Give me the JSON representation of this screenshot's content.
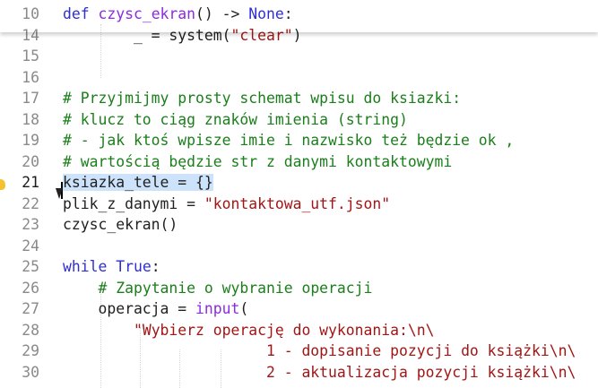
{
  "editor": {
    "lines": [
      {
        "num": "10",
        "parts": [
          {
            "t": "def",
            "c": "kw"
          },
          {
            "t": " "
          },
          {
            "t": "czysc_ekran",
            "c": "fn"
          },
          {
            "t": "() -> "
          },
          {
            "t": "None",
            "c": "kw"
          },
          {
            "t": ":"
          }
        ]
      },
      {
        "num": "14",
        "parts": [
          {
            "t": "        _ = system("
          },
          {
            "t": "\"clear\"",
            "c": "str"
          },
          {
            "t": ")"
          }
        ]
      },
      {
        "num": "15",
        "parts": []
      },
      {
        "num": "16",
        "parts": []
      },
      {
        "num": "17",
        "parts": [
          {
            "t": "# Przyjmijmy prosty schemat wpisu do ksiazki:",
            "c": "cm"
          }
        ]
      },
      {
        "num": "18",
        "parts": [
          {
            "t": "# klucz to ciąg znaków imienia (string)",
            "c": "cm"
          }
        ]
      },
      {
        "num": "19",
        "parts": [
          {
            "t": "# - jak ktoś wpisze imie i nazwisko też będzie ok ,",
            "c": "cm"
          }
        ]
      },
      {
        "num": "20",
        "parts": [
          {
            "t": "# wartością będzie str z danymi kontaktowymi",
            "c": "cm"
          }
        ]
      },
      {
        "num": "21",
        "current": true,
        "parts": [
          {
            "t": "ksiazka_tele = {}",
            "c": "sel"
          }
        ]
      },
      {
        "num": "22",
        "parts": [
          {
            "t": "plik_z_danymi = "
          },
          {
            "t": "\"kontaktowa_utf.json\"",
            "c": "str"
          }
        ]
      },
      {
        "num": "23",
        "parts": [
          {
            "t": "czysc_ekran()"
          }
        ]
      },
      {
        "num": "24",
        "parts": []
      },
      {
        "num": "25",
        "parts": [
          {
            "t": "while",
            "c": "kw"
          },
          {
            "t": " "
          },
          {
            "t": "True",
            "c": "kw"
          },
          {
            "t": ":"
          }
        ]
      },
      {
        "num": "26",
        "parts": [
          {
            "t": "    "
          },
          {
            "t": "# Zapytanie o wybranie operacji",
            "c": "cm"
          }
        ]
      },
      {
        "num": "27",
        "parts": [
          {
            "t": "    operacja = "
          },
          {
            "t": "input",
            "c": "fn"
          },
          {
            "t": "("
          }
        ]
      },
      {
        "num": "28",
        "parts": [
          {
            "t": "        "
          },
          {
            "t": "\"Wybierz operację do wykonania:\\n\\",
            "c": "str"
          }
        ]
      },
      {
        "num": "29",
        "parts": [
          {
            "t": "                       "
          },
          {
            "t": "1 - dopisanie pozycji do książki\\n\\",
            "c": "str"
          }
        ]
      },
      {
        "num": "30",
        "parts": [
          {
            "t": "                       "
          },
          {
            "t": "2 - aktualizacja pozycji książki\\n\\",
            "c": "str"
          }
        ]
      }
    ]
  },
  "colors": {
    "keyword": "#2f2fd0",
    "function": "#8a2be2",
    "string": "#a31515",
    "comment": "#1a7f1a",
    "selection": "#cde3fb"
  },
  "icons": [
    "lightbulb-icon",
    "mouse-pointer-icon"
  ]
}
